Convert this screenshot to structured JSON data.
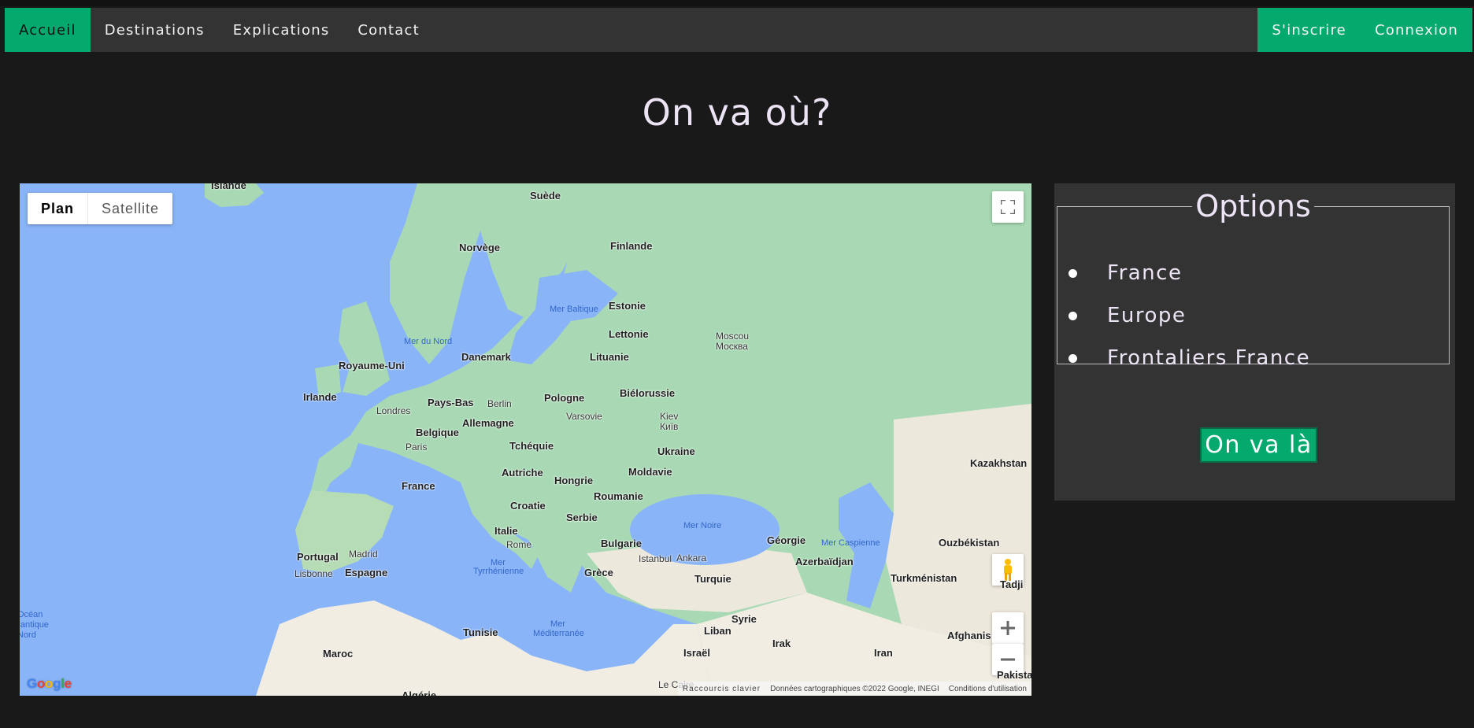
{
  "nav": {
    "left": [
      "Accueil",
      "Destinations",
      "Explications",
      "Contact"
    ],
    "right": [
      "S'inscrire",
      "Connexion"
    ]
  },
  "page": {
    "title": "On va où?"
  },
  "map": {
    "type_controls": [
      "Plan",
      "Satellite"
    ],
    "labels": {
      "islande": "Islande",
      "suede": "Suède",
      "norvege": "Norvège",
      "finlande": "Finlande",
      "mer_baltique": "Mer Baltique",
      "estonie": "Estonie",
      "mer_du_nord": "Mer du Nord",
      "lettonie": "Lettonie",
      "moscou": "Moscou",
      "moscou_ru": "Москва",
      "danemark": "Danemark",
      "lituanie": "Lituanie",
      "royaume_uni": "Royaume-Uni",
      "irlande": "Irlande",
      "bielorussie": "Biélorussie",
      "pays_bas": "Pays-Bas",
      "berlin": "Berlin",
      "pologne": "Pologne",
      "londres": "Londres",
      "allemagne": "Allemagne",
      "varsovie": "Varsovie",
      "kiev": "Kiev",
      "kiev_ua": "Київ",
      "belgique": "Belgique",
      "paris": "Paris",
      "tchequie": "Tchéquie",
      "ukraine": "Ukraine",
      "kazakhstan": "Kazakhstan",
      "autriche": "Autriche",
      "moldavie": "Moldavie",
      "france": "France",
      "hongrie": "Hongrie",
      "roumanie": "Roumanie",
      "croatie": "Croatie",
      "mer_noire": "Mer Noire",
      "serbie": "Serbie",
      "italie": "Italie",
      "georgie": "Géorgie",
      "mer_caspienne": "Mer Caspienne",
      "ouzbekistan": "Ouzbékistan",
      "rome": "Rome",
      "bulgarie": "Bulgarie",
      "portugal": "Portugal",
      "madrid": "Madrid",
      "mer": "Mer",
      "tyrrhenienne": "Tyrrhénienne",
      "istanbul": "Istanbul",
      "ankara": "Ankara",
      "azerbaidjan": "Azerbaïdjan",
      "lisbonne": "Lisbonne",
      "espagne": "Espagne",
      "grece": "Grèce",
      "turquie": "Turquie",
      "turkmenistan": "Turkménistan",
      "ocean_1": "Océan",
      "ocean_2": "Atlantique",
      "ocean_3": "Nord",
      "syrie": "Syrie",
      "mer_med_1": "Mer",
      "mer_med_2": "Méditerranée",
      "tunisie": "Tunisie",
      "liban": "Liban",
      "afghanistan": "Afghanis",
      "maroc": "Maroc",
      "irak": "Irak",
      "iran": "Iran",
      "israel": "Israël",
      "pakistan": "Pakista",
      "algerie": "Algérie",
      "le_caire": "Le Caire",
      "tadjik": "Tadji"
    },
    "footer": {
      "shortcuts": "Raccourcis clavier",
      "attribution": "Données cartographiques ©2022 Google, INEGI",
      "terms": "Conditions d'utilisation"
    },
    "logo": [
      "G",
      "o",
      "o",
      "g",
      "l",
      "e"
    ],
    "icons": [
      "fullscreen-icon",
      "pegman-icon",
      "zoom-in-icon",
      "zoom-out-icon"
    ]
  },
  "options": {
    "legend": "Options",
    "items": [
      "France",
      "Europe",
      "Frontaliers France"
    ]
  },
  "submit_label": "On va là",
  "colors": {
    "accent": "#04aa6d",
    "background": "#191919",
    "panel": "#333333",
    "water": "#8ab4f8",
    "land": "#a8d9b4"
  }
}
